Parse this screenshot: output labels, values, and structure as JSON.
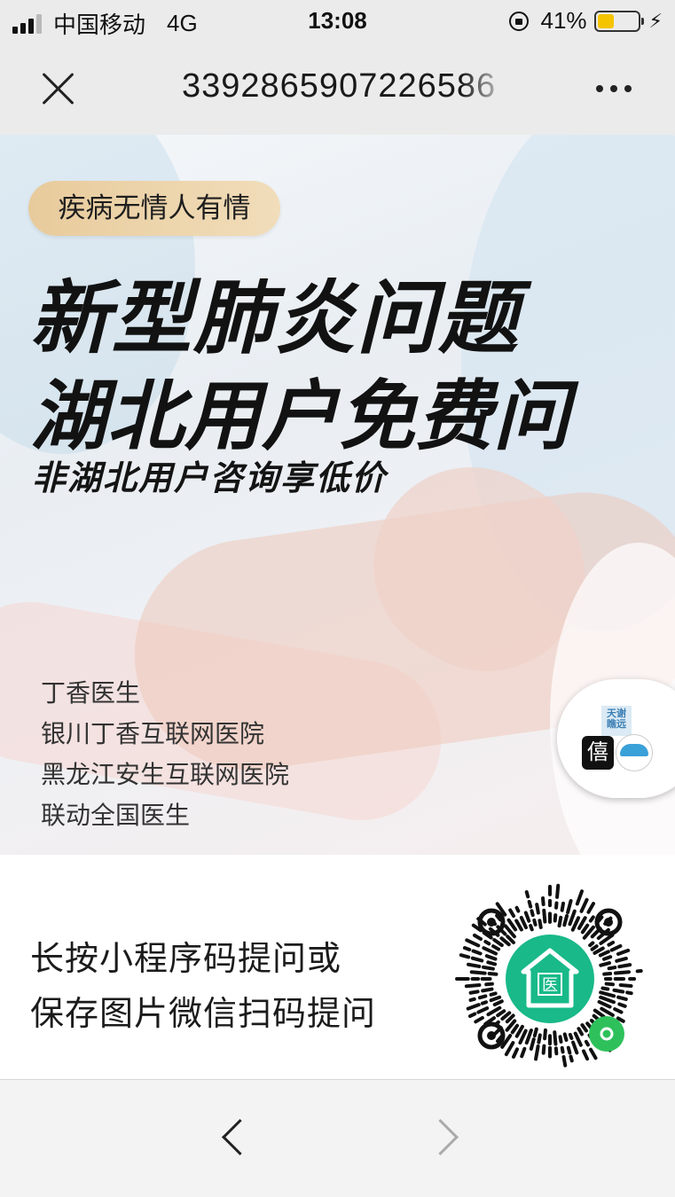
{
  "status_bar": {
    "carrier": "中国移动",
    "network": "4G",
    "time": "13:08",
    "battery_percent": "41%",
    "battery_level": 0.41,
    "battery_color": "#f5c400"
  },
  "nav_bar": {
    "title": "3392865907226586",
    "close_icon": "close-icon",
    "more_icon": "more-icon"
  },
  "poster": {
    "tag": "疾病无情人有情",
    "headline_line1": "新型肺炎问题",
    "headline_line2": "湖北用户免费问",
    "subheadline": "非湖北用户咨询享低价",
    "organizations": [
      "丁香医生",
      "银川丁香互联网医院",
      "黑龙江安生互联网医院",
      "联动全国医生"
    ],
    "floating_badge": {
      "line1": "天谢",
      "line2": "瞧远",
      "char": "僖"
    },
    "tag_color": "#e8cb9c"
  },
  "mini_program": {
    "instruction_line1": "长按小程序码提问或",
    "instruction_line2": "保存图片微信扫码提问",
    "qr_center_text": "医",
    "brand_color": "#19b989"
  },
  "bottom_bar": {
    "back_icon": "chevron-left-icon",
    "forward_icon": "chevron-right-icon"
  }
}
